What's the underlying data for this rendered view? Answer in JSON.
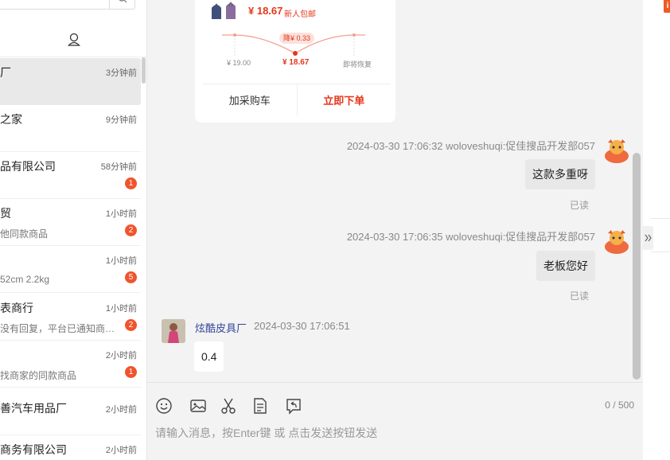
{
  "conversations": [
    {
      "name": "厂",
      "time": "3分钟前",
      "preview": "",
      "badge": ""
    },
    {
      "name": "之家",
      "time": "9分钟前",
      "preview": "",
      "badge": ""
    },
    {
      "name": "品有限公司",
      "time": "58分钟前",
      "preview": "",
      "badge": "1"
    },
    {
      "name": "贸",
      "time": "1小时前",
      "preview": "他同款商品",
      "badge": "2"
    },
    {
      "name": "",
      "time": "1小时前",
      "preview": "52cm 2.2kg",
      "badge": "5"
    },
    {
      "name": "表商行",
      "time": "1小时前",
      "preview": "没有回复，平台已通知商家...",
      "badge": "2"
    },
    {
      "name": "",
      "time": "2小时前",
      "preview": "找商家的同款商品",
      "badge": "1"
    },
    {
      "name": "善汽车用品厂",
      "time": "2小时前",
      "preview": "",
      "badge": ""
    },
    {
      "name": "商务有限公司",
      "time": "2小时前",
      "preview": "",
      "badge": ""
    }
  ],
  "product_card": {
    "price": "¥ 18.67",
    "tag": "新人包邮",
    "drop_label": "降¥ 0.33",
    "price_before": "¥ 19.00",
    "price_now": "¥ 18.67",
    "price_after": "即将恢复",
    "add_cart_label": "加采购车",
    "order_label": "立即下单"
  },
  "messages": [
    {
      "meta": "2024-03-30 17:06:32   woloveshuqi:促佳搜品开发部057",
      "text": "这款多重呀",
      "status": "已读"
    },
    {
      "meta": "2024-03-30 17:06:35   woloveshuqi:促佳搜品开发部057",
      "text": "老板您好",
      "status": "已读"
    }
  ],
  "incoming": {
    "name": "炫酷皮具厂",
    "time": "2024-03-30 17:06:51",
    "text": "0.4"
  },
  "input": {
    "placeholder": "请输入消息，按Enter键 或 点击发送按钮发送",
    "counter": "0 / 500"
  },
  "colors": {
    "accent": "#e5361b",
    "badge": "#f0542d",
    "sender_name": "#35459a"
  }
}
